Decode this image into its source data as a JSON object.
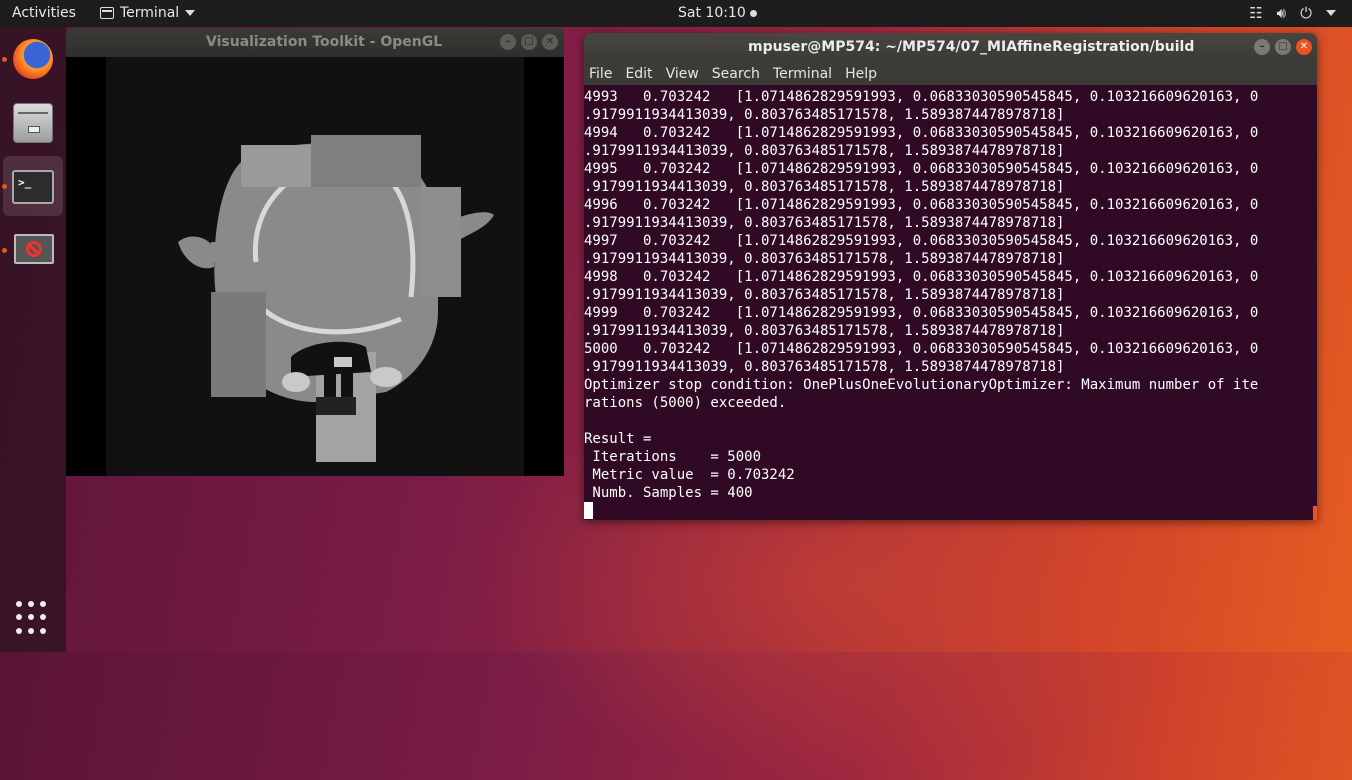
{
  "topbar": {
    "activities": "Activities",
    "app_menu": "Terminal",
    "clock": "Sat 10:10",
    "icons": [
      "network-icon",
      "volume-icon",
      "power-icon",
      "chevron-down-icon"
    ]
  },
  "dock": {
    "items": [
      {
        "name": "firefox",
        "running": true
      },
      {
        "name": "files",
        "running": false
      },
      {
        "name": "terminal",
        "running": true
      },
      {
        "name": "vtk-app",
        "running": true
      }
    ]
  },
  "vtk_window": {
    "title": "Visualization Toolkit - OpenGL"
  },
  "terminal": {
    "title": "mpuser@MP574: ~/MP574/07_MIAffineRegistration/build",
    "menu": [
      "File",
      "Edit",
      "View",
      "Search",
      "Terminal",
      "Help"
    ],
    "lines": [
      "4993   0.703242   [1.0714862829591993, 0.06833030590545845, 0.103216609620163, 0",
      ".9179911934413039, 0.803763485171578, 1.5893874478978718]",
      "4994   0.703242   [1.0714862829591993, 0.06833030590545845, 0.103216609620163, 0",
      ".9179911934413039, 0.803763485171578, 1.5893874478978718]",
      "4995   0.703242   [1.0714862829591993, 0.06833030590545845, 0.103216609620163, 0",
      ".9179911934413039, 0.803763485171578, 1.5893874478978718]",
      "4996   0.703242   [1.0714862829591993, 0.06833030590545845, 0.103216609620163, 0",
      ".9179911934413039, 0.803763485171578, 1.5893874478978718]",
      "4997   0.703242   [1.0714862829591993, 0.06833030590545845, 0.103216609620163, 0",
      ".9179911934413039, 0.803763485171578, 1.5893874478978718]",
      "4998   0.703242   [1.0714862829591993, 0.06833030590545845, 0.103216609620163, 0",
      ".9179911934413039, 0.803763485171578, 1.5893874478978718]",
      "4999   0.703242   [1.0714862829591993, 0.06833030590545845, 0.103216609620163, 0",
      ".9179911934413039, 0.803763485171578, 1.5893874478978718]",
      "5000   0.703242   [1.0714862829591993, 0.06833030590545845, 0.103216609620163, 0",
      ".9179911934413039, 0.803763485171578, 1.5893874478978718]",
      "Optimizer stop condition: OnePlusOneEvolutionaryOptimizer: Maximum number of ite",
      "rations (5000) exceeded.",
      "",
      "Result =",
      " Iterations    = 5000",
      " Metric value  = 0.703242",
      " Numb. Samples = 400"
    ]
  }
}
